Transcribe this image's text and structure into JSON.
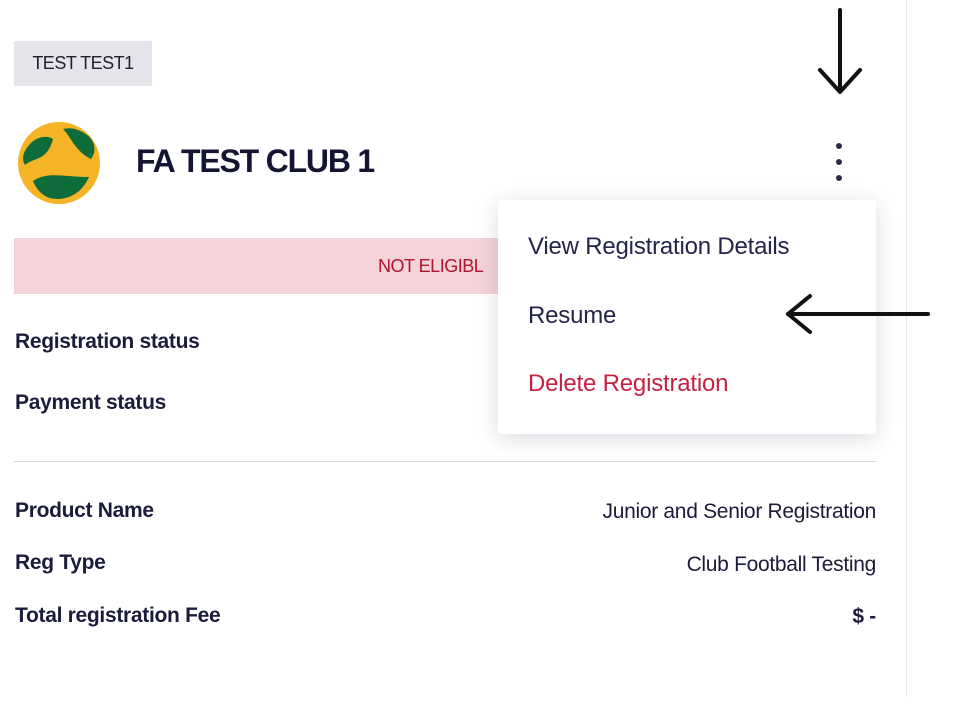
{
  "header": {
    "tag": "TEST TEST1",
    "club_name": "FA TEST CLUB 1",
    "logo_icon": "football-australia-logo",
    "more_icon": "more-vertical-icon"
  },
  "banner": {
    "text": "NOT ELIGIBL",
    "color": "#b0142f",
    "background": "#f4d3d8"
  },
  "status": {
    "registration_label": "Registration status",
    "payment_label": "Payment status"
  },
  "details": [
    {
      "label": "Product Name",
      "value": "Junior and Senior Registration"
    },
    {
      "label": "Reg Type",
      "value": "Club Football Testing"
    },
    {
      "label": "Total registration Fee",
      "value": "$ -"
    }
  ],
  "menu": {
    "items": [
      {
        "label": "View Registration Details"
      },
      {
        "label": "Resume"
      },
      {
        "label": "Delete Registration"
      }
    ],
    "danger_color": "#c8203f"
  },
  "annotations": {
    "down_arrow_icon": "arrow-down-icon",
    "left_arrow_icon": "arrow-left-icon"
  }
}
